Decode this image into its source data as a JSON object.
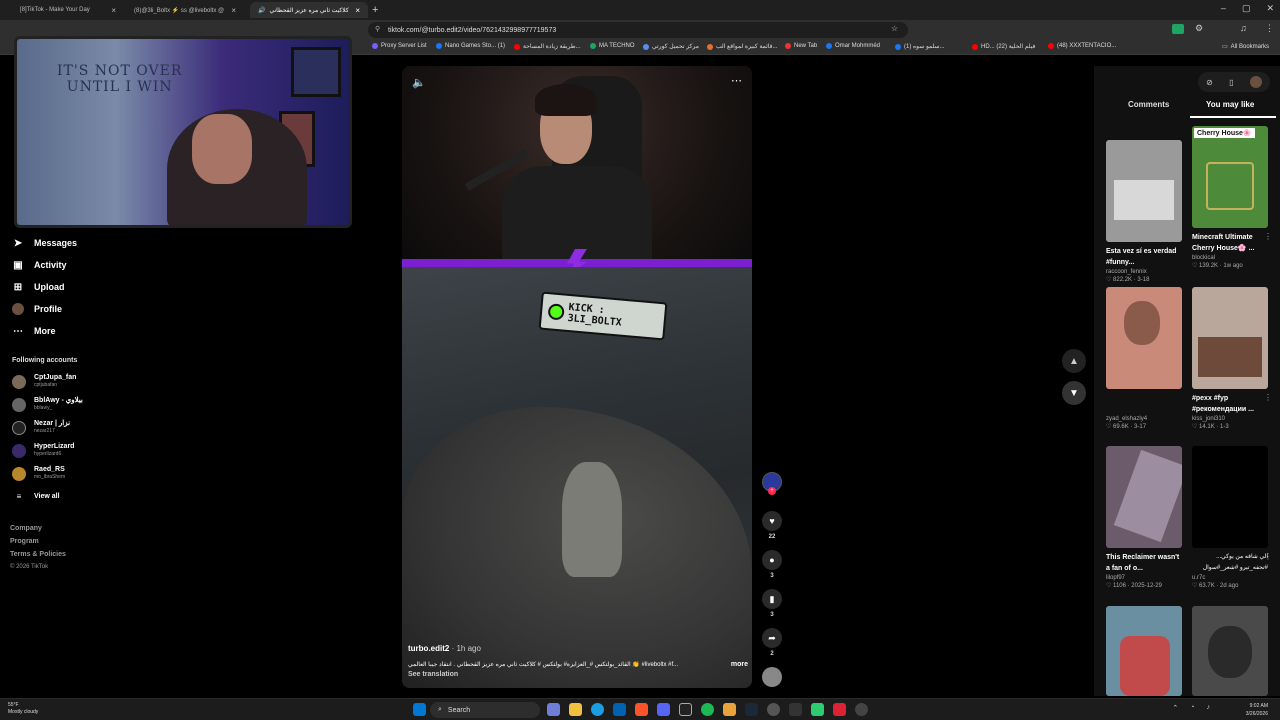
{
  "browser": {
    "tabs": [
      {
        "label": "[8]TikTok - Make Your Day"
      },
      {
        "label": "(8)@3li_Boltx ⚡ ss @liveboltx @"
      },
      {
        "label": "كلاكيت ثاني مره عزيز القحطاني"
      }
    ],
    "new_tab": "+",
    "url": "tiktok.com/@turbo.edit2/video/7621432998977719573",
    "window_controls": [
      "–",
      "▢",
      "✕"
    ],
    "bookmarks": [
      {
        "label": "Proxy Server List",
        "color": "#7b5cff"
      },
      {
        "label": "Nano Games Sto... (1)",
        "color": "#1877f2"
      },
      {
        "label": "طريقة زيادة المساحة...",
        "color": "#ff0000"
      },
      {
        "label": "MA TECHNO",
        "color": "#1fa463"
      },
      {
        "label": "مركز تحميل كورتي",
        "color": "#5b8def"
      },
      {
        "label": "قائمة كبيرة لمواقع الب...",
        "color": "#e46f2a"
      },
      {
        "label": "New Tab",
        "color": "#e33"
      },
      {
        "label": "Omar Mohmméd",
        "color": "#1877f2"
      },
      {
        "label": "(1) سلمو سوه...",
        "color": "#1877f2"
      },
      {
        "label": "HD... فيلم الحلية (22)",
        "color": "#ff0000"
      },
      {
        "label": "(48) XXXTENTACIO...",
        "color": "#ff0000"
      },
      {
        "label": "All Bookmarks",
        "color": "#cccccc"
      }
    ]
  },
  "webcam": {
    "poster_line1": "IT'S NOT OVER",
    "poster_line2": "UNTIL I WIN"
  },
  "sidebar": {
    "nav": [
      {
        "label": "Messages",
        "icon": "send-icon"
      },
      {
        "label": "Activity",
        "icon": "bell-icon"
      },
      {
        "label": "Upload",
        "icon": "plus-square-icon"
      },
      {
        "label": "Profile",
        "icon": "avatar"
      },
      {
        "label": "More",
        "icon": "ellipsis-icon"
      }
    ],
    "following_title": "Following accounts",
    "accounts": [
      {
        "name": "CptJupa_fan",
        "handle": "cptjubafan"
      },
      {
        "name": "BblAwy - بيلاوي",
        "handle": "bblawy_"
      },
      {
        "name": "Nezar | نزار",
        "handle": "nezar217"
      },
      {
        "name": "HyperLizard",
        "handle": "hyperlizard6"
      },
      {
        "name": "Raed_RS",
        "handle": "mo_lbraShem"
      }
    ],
    "view_all": "View all",
    "footer": [
      "Company",
      "Program",
      "Terms & Policies",
      "© 2026 TikTok"
    ]
  },
  "video": {
    "overlay_tag": "KICK : 3LI_BOLTX",
    "author": "turbo.edit2",
    "time_ago": "· 1h ago",
    "caption": "القائد_بولتكس #_العزايزة# بولتكس #  كلاكيت ثاني مره عزيز القحطاني . انتقاد جيبا العالمي 👏 #liveboltx #f...",
    "more": "more",
    "see_translation": "See translation"
  },
  "actions": {
    "likes": "22",
    "comments": "3",
    "saves": "3",
    "shares": "2"
  },
  "right_panel": {
    "tabs": [
      "Comments",
      "You may like"
    ],
    "cards": [
      {
        "title": "Esta vez sí es verdad #funny...",
        "user": "raccoon_fennix",
        "meta": "♡ 822.2K · 3-18",
        "bg": "#9a9a9a"
      },
      {
        "title": "Minecraft Ultimate Cherry House🌸 ...",
        "user": "blockical",
        "meta": "♡ 139.2K · 1w ago",
        "bg": "#4d8a3a",
        "badge": "Cherry House🌸"
      },
      {
        "title": "",
        "user": "zyad_elshazly4",
        "meta": "♡ 69.6K · 3-17",
        "bg": "#c98a7a"
      },
      {
        "title": "#pexx #fyp #рекомендации ...",
        "user": "kiss_joni310",
        "meta": "♡ 14.1K · 1-3",
        "bg": "#b9a79c"
      },
      {
        "title": "This Reclaimer wasn't a fan of o...",
        "user": "lilopf97",
        "meta": "♡ 1106 · 2025-12-29",
        "bg": "#6b5b6b"
      },
      {
        "title": "الي شافه من يوكي... #تحفه_تيرو #شعر_#سوال",
        "user": "u.r7c",
        "meta": "♡ 63.7K · 2d ago",
        "bg": "#000000"
      },
      {
        "title": "",
        "user": "",
        "meta": "",
        "bg": "#6a8fa0"
      },
      {
        "title": "",
        "user": "",
        "meta": "",
        "bg": "#4a4a4a"
      }
    ]
  },
  "taskbar": {
    "weather_temp": "55°F",
    "weather_desc": "Mostly cloudy",
    "search": "Search",
    "time": "9:02 AM",
    "date": "3/26/2026"
  }
}
